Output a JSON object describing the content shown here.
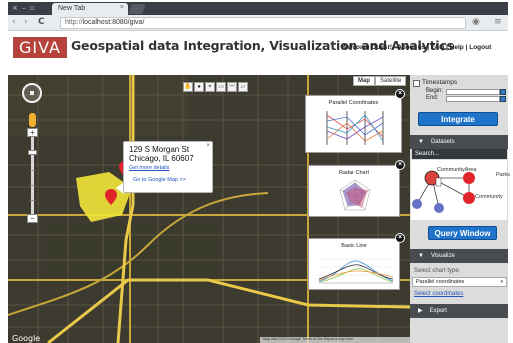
{
  "browser": {
    "window_buttons": "× – ▫",
    "tab_title": "New Tab",
    "tab_close": "×",
    "url_scheme": "http://",
    "url_host": "localhost:8080/giva/",
    "nav": {
      "back": "‹",
      "forward": "›",
      "reload": "C"
    },
    "icons": {
      "bookmark": "☆",
      "menu": "≡",
      "ext": "◉"
    }
  },
  "header": {
    "logo": "GIVA",
    "title": "Geospatial data Integration, Visualization and Analytics",
    "welcome": "Welcome Guest!",
    "links": [
      "About us",
      "FAQ",
      "Help",
      "Logout"
    ],
    "separator": "|"
  },
  "map": {
    "map_type_buttons": [
      "Map",
      "Satellite"
    ],
    "draw_tools": [
      "✋",
      "●",
      "⌖",
      "▭",
      "〰",
      "▱"
    ],
    "zoom_in": "+",
    "zoom_out": "−",
    "info_window": {
      "line1": "129 S Morgan St",
      "line2": "Chicago, IL 60607",
      "more_link": "Get more details",
      "google_link": "Go to Google Map >>",
      "close": "×"
    },
    "panels": [
      {
        "title": "Parallel Coordinates",
        "close": "×"
      },
      {
        "title": "Radar Chart",
        "close": "×"
      },
      {
        "title": "Basic Line",
        "close": "×"
      }
    ],
    "google_logo": "Google",
    "attribution": "Map data ©2013 Google  Terms of Use  Report a map error"
  },
  "sidebar": {
    "timestamps_label": "Timestamps",
    "begin_label": "Begin:",
    "end_label": "End:",
    "integrate_button": "Integrate",
    "datasets_header": "Datasets",
    "search_placeholder": "Search...",
    "graph_labels": [
      "CommunityArea",
      "Parks",
      "Community"
    ],
    "query_button": "Query Window",
    "visualize_header": "Visualize",
    "chart_type_label": "Select chart type:",
    "chart_type_value": "Parallel coordinates",
    "select_coordinates_link": "Select coordinates",
    "export_header": "Export",
    "collapse_arrow": "▼",
    "expand_arrow": "▶"
  },
  "colors": {
    "brand": "#b5433c",
    "button_blue": "#1f73c9",
    "section_header": "#484b4f",
    "map_background": "#3d3a30",
    "highlight_polygon": "#f2e53a",
    "marker_red": "#e0262b",
    "node_blue": "#6673c4"
  }
}
